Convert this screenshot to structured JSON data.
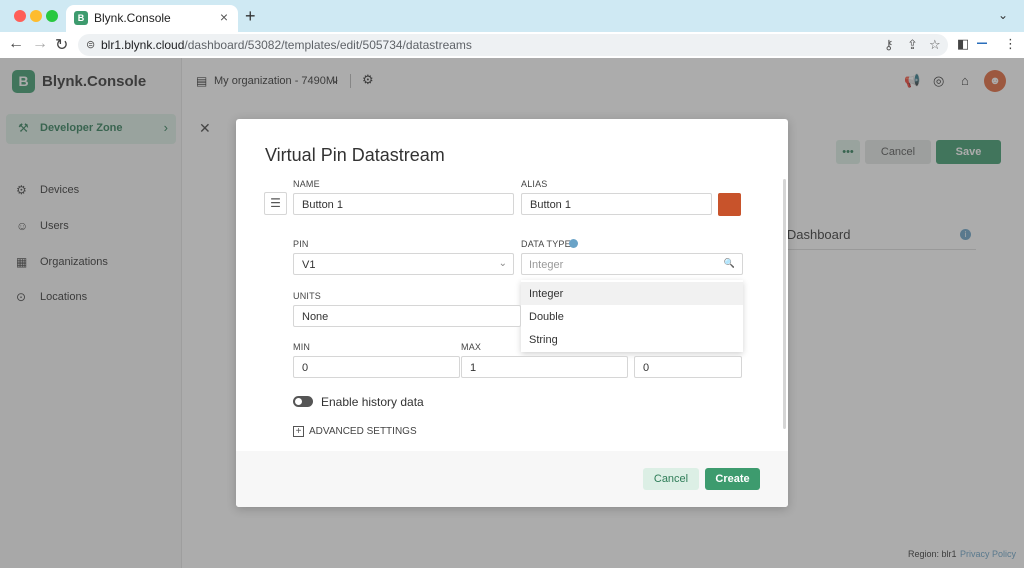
{
  "browser": {
    "tab_title": "Blynk.Console",
    "url_host": "blr1.blynk.cloud",
    "url_path": "/dashboard/53082/templates/edit/505734/datastreams"
  },
  "sidebar": {
    "brand": "Blynk.Console",
    "developer_zone": "Developer Zone",
    "items": [
      {
        "label": "Devices",
        "icon": "devices-icon"
      },
      {
        "label": "Users",
        "icon": "users-icon"
      },
      {
        "label": "Organizations",
        "icon": "organizations-icon"
      },
      {
        "label": "Locations",
        "icon": "location-pin-icon"
      }
    ]
  },
  "header": {
    "organization": "My organization - 7490MI"
  },
  "page": {
    "cancel_label": "Cancel",
    "save_label": "Save",
    "dashboard_text": "e Dashboard",
    "region": "Region: blr1",
    "privacy": "Privacy Policy"
  },
  "modal": {
    "title": "Virtual Pin Datastream",
    "name_label": "NAME",
    "name_value": "Button 1",
    "alias_label": "ALIAS",
    "alias_value": "Button 1",
    "color": "#c8532b",
    "pin_label": "PIN",
    "pin_value": "V1",
    "data_type_label": "DATA TYPE",
    "data_type_placeholder": "Integer",
    "data_type_options": [
      "Integer",
      "Double",
      "String"
    ],
    "units_label": "UNITS",
    "units_value": "None",
    "min_label": "MIN",
    "min_value": "0",
    "max_label": "MAX",
    "max_value": "1",
    "default_value": "0",
    "history_label": "Enable history data",
    "advanced_label": "ADVANCED SETTINGS",
    "cancel_label": "Cancel",
    "create_label": "Create"
  },
  "colors": {
    "brand_green": "#3d9b6e",
    "accent_light_green": "#dcefe5"
  }
}
